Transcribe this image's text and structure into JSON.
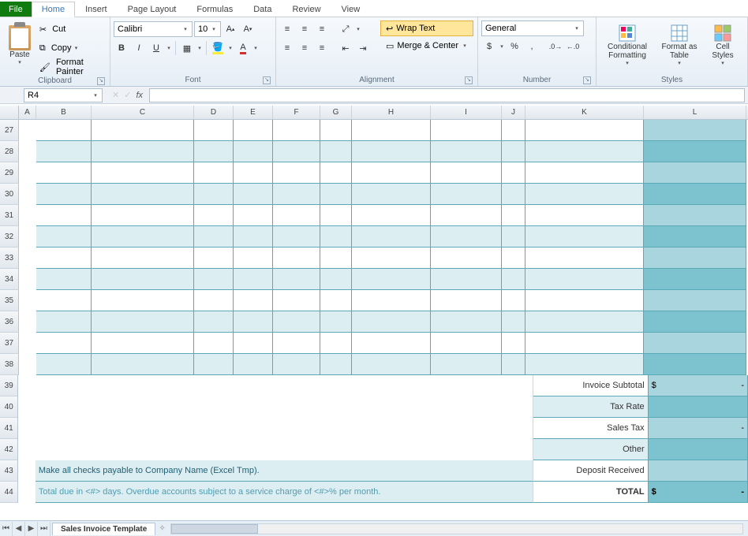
{
  "tabs": {
    "file": "File",
    "home": "Home",
    "insert": "Insert",
    "page_layout": "Page Layout",
    "formulas": "Formulas",
    "data": "Data",
    "review": "Review",
    "view": "View"
  },
  "ribbon": {
    "clipboard": {
      "paste": "Paste",
      "cut": "Cut",
      "copy": "Copy",
      "format_painter": "Format Painter",
      "label": "Clipboard"
    },
    "font": {
      "name": "Calibri",
      "size": "10",
      "bold": "B",
      "italic": "I",
      "underline": "U",
      "label": "Font"
    },
    "alignment": {
      "wrap": "Wrap Text",
      "merge": "Merge & Center",
      "label": "Alignment"
    },
    "number": {
      "format": "General",
      "label": "Number"
    },
    "styles": {
      "cond": "Conditional Formatting",
      "table": "Format as Table",
      "cell": "Cell Styles",
      "label": "Styles"
    }
  },
  "namebox": "R4",
  "columns": [
    {
      "id": "A",
      "w": 22
    },
    {
      "id": "B",
      "w": 70
    },
    {
      "id": "C",
      "w": 130
    },
    {
      "id": "D",
      "w": 50
    },
    {
      "id": "E",
      "w": 50
    },
    {
      "id": "F",
      "w": 60
    },
    {
      "id": "G",
      "w": 40
    },
    {
      "id": "H",
      "w": 100
    },
    {
      "id": "I",
      "w": 90
    },
    {
      "id": "J",
      "w": 30
    },
    {
      "id": "K",
      "w": 150
    },
    {
      "id": "L",
      "w": 130
    }
  ],
  "first_row": 27,
  "table_rows": 12,
  "summary": {
    "subtotal": "Invoice Subtotal",
    "subtotal_val_l": "$",
    "subtotal_val_r": "-",
    "tax_rate": "Tax Rate",
    "tax_rate_val": "",
    "sales_tax": "Sales Tax",
    "sales_tax_val": "-",
    "other": "Other",
    "other_val": "",
    "deposit": "Deposit Received",
    "deposit_val": "",
    "total": "TOTAL",
    "total_val_l": "$",
    "total_val_r": "-"
  },
  "notes": {
    "line1": "Make all checks payable to Company Name (Excel Tmp).",
    "line2": "Total due in <#> days. Overdue accounts subject to a service charge of <#>% per month."
  },
  "sheet": "Sales Invoice Template"
}
